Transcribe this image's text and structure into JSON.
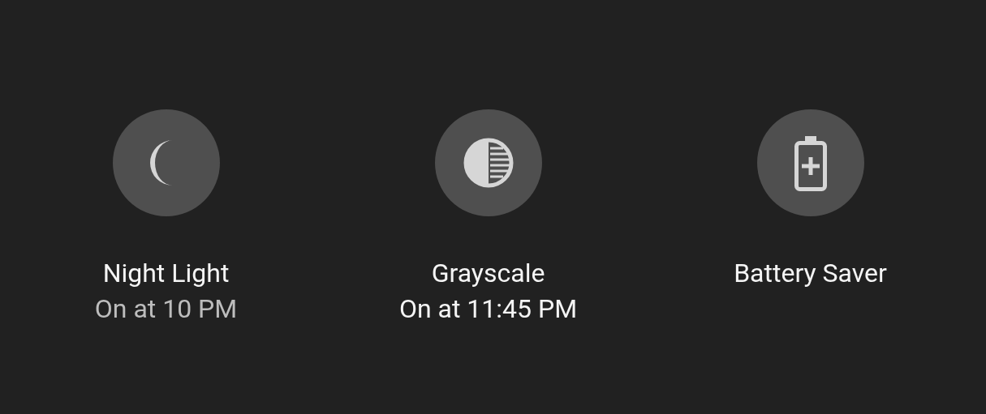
{
  "tiles": [
    {
      "kind": "moon",
      "label": "Night Light",
      "subtitle": {
        "text": "On at 10 PM",
        "bright": false
      }
    },
    {
      "kind": "contrast",
      "label": "Grayscale",
      "subtitle": {
        "text": "On at 11:45 PM",
        "bright": true
      }
    },
    {
      "kind": "battery",
      "label": "Battery Saver"
    }
  ]
}
